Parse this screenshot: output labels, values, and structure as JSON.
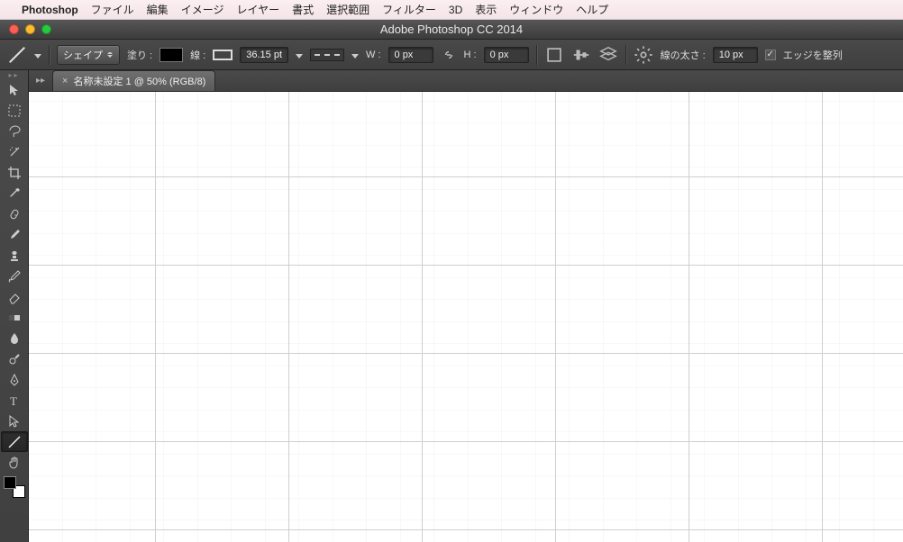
{
  "mac_menu": {
    "app_name": "Photoshop",
    "items": [
      "ファイル",
      "編集",
      "イメージ",
      "レイヤー",
      "書式",
      "選択範囲",
      "フィルター",
      "3D",
      "表示",
      "ウィンドウ",
      "ヘルプ"
    ]
  },
  "window": {
    "title": "Adobe Photoshop CC 2014"
  },
  "options_bar": {
    "mode_label": "シェイプ",
    "fill_label": "塗り :",
    "stroke_label": "線 :",
    "stroke_width": "36.15 pt",
    "w_label": "W :",
    "w_value": "0 px",
    "h_label": "H :",
    "h_value": "0 px",
    "line_weight_label": "線の太さ :",
    "line_weight_value": "10 px",
    "align_edges_label": "エッジを整列"
  },
  "document": {
    "tab_title": "名称未設定 1 @ 50% (RGB/8)"
  },
  "tools": [
    "move-tool",
    "marquee-tool",
    "lasso-tool",
    "wand-tool",
    "crop-tool",
    "eyedropper-tool",
    "heal-tool",
    "brush-tool",
    "stamp-tool",
    "history-tool",
    "eraser-tool",
    "gradient-tool",
    "blur-tool",
    "dodge-tool",
    "pen-tool",
    "type-tool",
    "path-select-tool",
    "line-tool",
    "hand-tool"
  ]
}
